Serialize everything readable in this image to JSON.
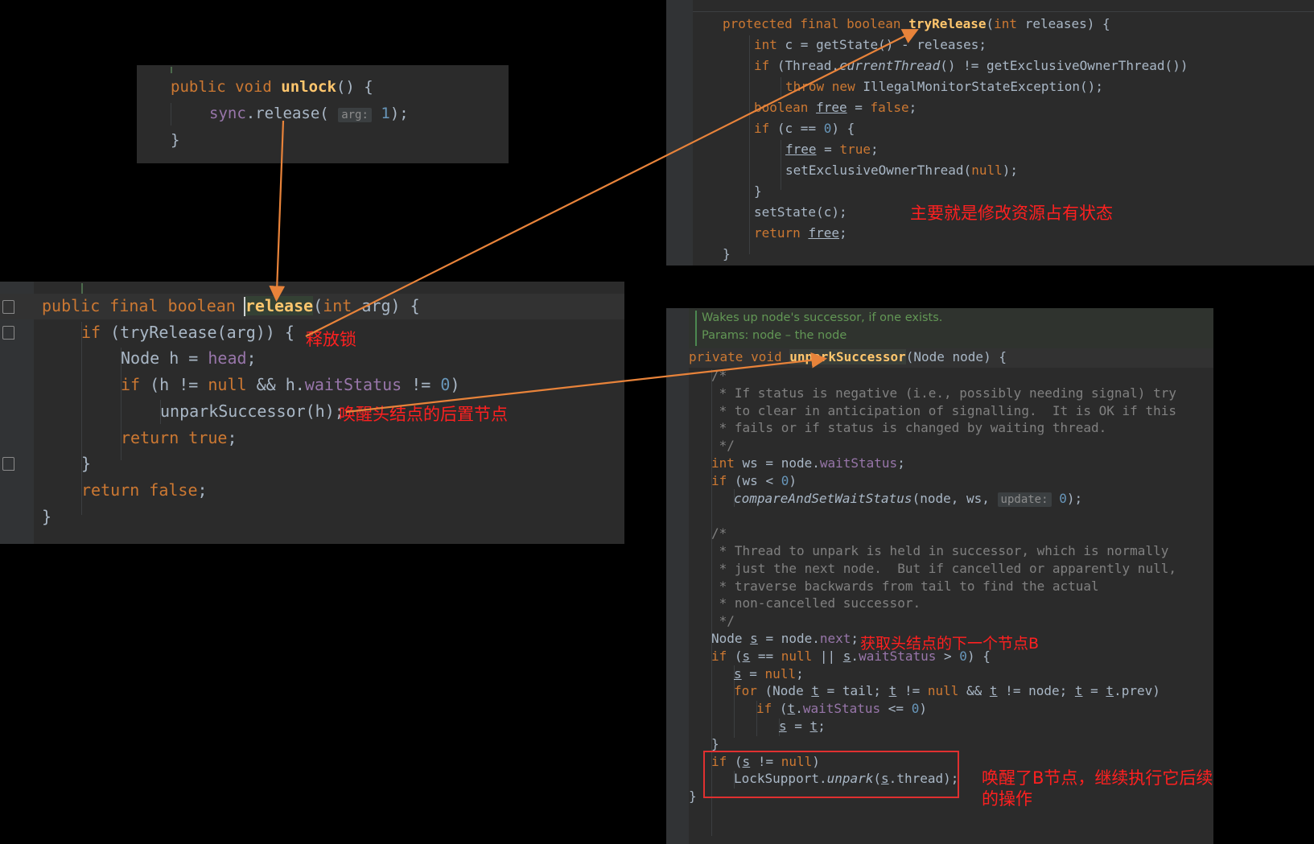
{
  "snippet_panel": {
    "name": "unlock-snippet",
    "lines": [
      {
        "indent": 0,
        "tokens": [
          {
            "t": "public ",
            "c": "kw"
          },
          {
            "t": "void ",
            "c": "kw"
          },
          {
            "t": "unlock",
            "c": "fnb"
          },
          {
            "t": "() {",
            "c": "plain"
          }
        ]
      },
      {
        "indent": 1,
        "tokens": [
          {
            "t": "sync",
            "c": "fld"
          },
          {
            "t": ".",
            "c": "plain"
          },
          {
            "t": "release",
            "c": "plain"
          },
          {
            "t": "( ",
            "c": "plain"
          },
          {
            "t": "arg:",
            "c": "hintbox"
          },
          {
            "t": " ",
            "c": "plain"
          },
          {
            "t": "1",
            "c": "num"
          },
          {
            "t": ");",
            "c": "plain"
          }
        ]
      },
      {
        "indent": 0,
        "tokens": [
          {
            "t": "}",
            "c": "plain"
          }
        ]
      }
    ]
  },
  "main_panel": {
    "name": "aqs-release-method",
    "lines": [
      {
        "indent": 0,
        "tokens": [
          {
            "t": "public ",
            "c": "kw"
          },
          {
            "t": "final ",
            "c": "kw"
          },
          {
            "t": "boolean ",
            "c": "kw"
          },
          {
            "t": "release",
            "c": "fnb sel"
          },
          {
            "t": "(",
            "c": "plain"
          },
          {
            "t": "int ",
            "c": "kw"
          },
          {
            "t": "arg",
            "c": "plain"
          },
          {
            "t": ") {",
            "c": "plain"
          }
        ]
      },
      {
        "indent": 1,
        "tokens": [
          {
            "t": "if ",
            "c": "kw"
          },
          {
            "t": "(tryRelease(arg)) {",
            "c": "plain"
          }
        ]
      },
      {
        "indent": 2,
        "tokens": [
          {
            "t": "Node h = ",
            "c": "plain"
          },
          {
            "t": "head",
            "c": "fld"
          },
          {
            "t": ";",
            "c": "plain"
          }
        ]
      },
      {
        "indent": 2,
        "tokens": [
          {
            "t": "if ",
            "c": "kw"
          },
          {
            "t": "(h != ",
            "c": "plain"
          },
          {
            "t": "null",
            "c": "kw"
          },
          {
            "t": " && h.",
            "c": "plain"
          },
          {
            "t": "waitStatus",
            "c": "fld"
          },
          {
            "t": " != ",
            "c": "plain"
          },
          {
            "t": "0",
            "c": "num"
          },
          {
            "t": ")",
            "c": "plain"
          }
        ]
      },
      {
        "indent": 3,
        "tokens": [
          {
            "t": "unparkSuccessor(h);",
            "c": "plain"
          }
        ]
      },
      {
        "indent": 2,
        "tokens": [
          {
            "t": "return ",
            "c": "kw"
          },
          {
            "t": "true",
            "c": "kw"
          },
          {
            "t": ";",
            "c": "plain"
          }
        ]
      },
      {
        "indent": 1,
        "tokens": [
          {
            "t": "}",
            "c": "plain"
          }
        ]
      },
      {
        "indent": 1,
        "tokens": [
          {
            "t": "return ",
            "c": "kw"
          },
          {
            "t": "false",
            "c": "kw"
          },
          {
            "t": ";",
            "c": "plain"
          }
        ]
      },
      {
        "indent": 0,
        "tokens": [
          {
            "t": "}",
            "c": "plain"
          }
        ]
      }
    ]
  },
  "top_right_panel": {
    "name": "try-release-method",
    "lines": [
      {
        "indent": 0,
        "tokens": [
          {
            "t": "protected ",
            "c": "kw"
          },
          {
            "t": "final ",
            "c": "kw"
          },
          {
            "t": "boolean ",
            "c": "kw"
          },
          {
            "t": "tryRelease",
            "c": "fnb"
          },
          {
            "t": "(",
            "c": "plain"
          },
          {
            "t": "int ",
            "c": "kw"
          },
          {
            "t": "releases",
            "c": "plain"
          },
          {
            "t": ") {",
            "c": "plain"
          }
        ]
      },
      {
        "indent": 1,
        "tokens": [
          {
            "t": "int ",
            "c": "kw"
          },
          {
            "t": "c = getState() - releases;",
            "c": "plain"
          }
        ]
      },
      {
        "indent": 1,
        "tokens": [
          {
            "t": "if ",
            "c": "kw"
          },
          {
            "t": "(Thread.",
            "c": "plain"
          },
          {
            "t": "currentThread",
            "c": "plain ital"
          },
          {
            "t": "() != getExclusiveOwnerThread())",
            "c": "plain"
          }
        ]
      },
      {
        "indent": 2,
        "tokens": [
          {
            "t": "throw ",
            "c": "kw"
          },
          {
            "t": "new ",
            "c": "kw"
          },
          {
            "t": "IllegalMonitorStateException();",
            "c": "plain"
          }
        ]
      },
      {
        "indent": 1,
        "tokens": [
          {
            "t": "boolean ",
            "c": "kw"
          },
          {
            "t": "free",
            "c": "loc"
          },
          {
            "t": " = ",
            "c": "plain"
          },
          {
            "t": "false",
            "c": "kw"
          },
          {
            "t": ";",
            "c": "plain"
          }
        ]
      },
      {
        "indent": 1,
        "tokens": [
          {
            "t": "if ",
            "c": "kw"
          },
          {
            "t": "(c == ",
            "c": "plain"
          },
          {
            "t": "0",
            "c": "num"
          },
          {
            "t": ") {",
            "c": "plain"
          }
        ]
      },
      {
        "indent": 2,
        "tokens": [
          {
            "t": "free",
            "c": "loc"
          },
          {
            "t": " = ",
            "c": "plain"
          },
          {
            "t": "true",
            "c": "kw"
          },
          {
            "t": ";",
            "c": "plain"
          }
        ]
      },
      {
        "indent": 2,
        "tokens": [
          {
            "t": "setExclusiveOwnerThread(",
            "c": "plain"
          },
          {
            "t": "null",
            "c": "kw"
          },
          {
            "t": ");",
            "c": "plain"
          }
        ]
      },
      {
        "indent": 1,
        "tokens": [
          {
            "t": "}",
            "c": "plain"
          }
        ]
      },
      {
        "indent": 1,
        "tokens": [
          {
            "t": "setState(c);",
            "c": "plain"
          }
        ]
      },
      {
        "indent": 1,
        "tokens": [
          {
            "t": "return ",
            "c": "kw"
          },
          {
            "t": "free",
            "c": "loc"
          },
          {
            "t": ";",
            "c": "plain"
          }
        ]
      },
      {
        "indent": 0,
        "tokens": [
          {
            "t": "}",
            "c": "plain"
          }
        ]
      }
    ]
  },
  "bottom_right_panel": {
    "name": "unpark-successor-method",
    "doc_lines": [
      "Wakes up node's successor, if one exists.",
      "Params: node – the node"
    ],
    "signature": [
      {
        "t": "private ",
        "c": "kw"
      },
      {
        "t": "void ",
        "c": "kw"
      },
      {
        "t": "unparkSuccessor",
        "c": "fnb hl"
      },
      {
        "t": "(Node node) {",
        "c": "plain"
      }
    ],
    "lines": [
      {
        "indent": 1,
        "tokens": [
          {
            "t": "/*",
            "c": "cmt"
          }
        ]
      },
      {
        "indent": 1,
        "tokens": [
          {
            "t": " * If status is negative (i.e., possibly needing signal) try",
            "c": "cmt"
          }
        ]
      },
      {
        "indent": 1,
        "tokens": [
          {
            "t": " * to clear in anticipation of signalling.  It is OK if this",
            "c": "cmt"
          }
        ]
      },
      {
        "indent": 1,
        "tokens": [
          {
            "t": " * fails or if status is changed by waiting thread.",
            "c": "cmt"
          }
        ]
      },
      {
        "indent": 1,
        "tokens": [
          {
            "t": " */",
            "c": "cmt"
          }
        ]
      },
      {
        "indent": 1,
        "tokens": [
          {
            "t": "int ",
            "c": "kw"
          },
          {
            "t": "ws = node.",
            "c": "plain"
          },
          {
            "t": "waitStatus",
            "c": "fld"
          },
          {
            "t": ";",
            "c": "plain"
          }
        ]
      },
      {
        "indent": 1,
        "tokens": [
          {
            "t": "if ",
            "c": "kw"
          },
          {
            "t": "(ws < ",
            "c": "plain"
          },
          {
            "t": "0",
            "c": "num"
          },
          {
            "t": ")",
            "c": "plain"
          }
        ]
      },
      {
        "indent": 2,
        "tokens": [
          {
            "t": "compareAndSetWaitStatus",
            "c": "plain ital"
          },
          {
            "t": "(node, ws, ",
            "c": "plain"
          },
          {
            "t": "update:",
            "c": "hintbox"
          },
          {
            "t": " ",
            "c": "plain"
          },
          {
            "t": "0",
            "c": "num"
          },
          {
            "t": ");",
            "c": "plain"
          }
        ]
      },
      {
        "indent": 1,
        "tokens": []
      },
      {
        "indent": 1,
        "tokens": [
          {
            "t": "/*",
            "c": "cmt"
          }
        ]
      },
      {
        "indent": 1,
        "tokens": [
          {
            "t": " * Thread to unpark is held in successor, which is normally",
            "c": "cmt"
          }
        ]
      },
      {
        "indent": 1,
        "tokens": [
          {
            "t": " * just the next node.  But if cancelled or apparently null,",
            "c": "cmt"
          }
        ]
      },
      {
        "indent": 1,
        "tokens": [
          {
            "t": " * traverse backwards from tail to find the actual",
            "c": "cmt"
          }
        ]
      },
      {
        "indent": 1,
        "tokens": [
          {
            "t": " * non-cancelled successor.",
            "c": "cmt"
          }
        ]
      },
      {
        "indent": 1,
        "tokens": [
          {
            "t": " */",
            "c": "cmt"
          }
        ]
      },
      {
        "indent": 1,
        "tokens": [
          {
            "t": "Node ",
            "c": "plain"
          },
          {
            "t": "s",
            "c": "loc"
          },
          {
            "t": " = node.",
            "c": "plain"
          },
          {
            "t": "next",
            "c": "fld"
          },
          {
            "t": ";",
            "c": "plain"
          }
        ]
      },
      {
        "indent": 1,
        "tokens": [
          {
            "t": "if ",
            "c": "kw"
          },
          {
            "t": "(",
            "c": "plain"
          },
          {
            "t": "s",
            "c": "loc"
          },
          {
            "t": " == ",
            "c": "plain"
          },
          {
            "t": "null",
            "c": "kw"
          },
          {
            "t": " || ",
            "c": "plain"
          },
          {
            "t": "s",
            "c": "loc"
          },
          {
            "t": ".",
            "c": "plain"
          },
          {
            "t": "waitStatus",
            "c": "fld"
          },
          {
            "t": " > ",
            "c": "plain"
          },
          {
            "t": "0",
            "c": "num"
          },
          {
            "t": ") {",
            "c": "plain"
          }
        ]
      },
      {
        "indent": 2,
        "tokens": [
          {
            "t": "s",
            "c": "loc"
          },
          {
            "t": " = ",
            "c": "plain"
          },
          {
            "t": "null",
            "c": "kw"
          },
          {
            "t": ";",
            "c": "plain"
          }
        ]
      },
      {
        "indent": 2,
        "tokens": [
          {
            "t": "for ",
            "c": "kw"
          },
          {
            "t": "(Node ",
            "c": "plain"
          },
          {
            "t": "t",
            "c": "loc"
          },
          {
            "t": " = ",
            "c": "plain"
          },
          {
            "t": "tail",
            "c": "plain"
          },
          {
            "t": "; ",
            "c": "plain"
          },
          {
            "t": "t",
            "c": "loc"
          },
          {
            "t": " != ",
            "c": "plain"
          },
          {
            "t": "null",
            "c": "kw"
          },
          {
            "t": " && ",
            "c": "plain"
          },
          {
            "t": "t",
            "c": "loc"
          },
          {
            "t": " != node; ",
            "c": "plain"
          },
          {
            "t": "t",
            "c": "loc"
          },
          {
            "t": " = ",
            "c": "plain"
          },
          {
            "t": "t",
            "c": "loc"
          },
          {
            "t": ".",
            "c": "plain"
          },
          {
            "t": "prev",
            "c": "plain"
          },
          {
            "t": ")",
            "c": "plain"
          }
        ]
      },
      {
        "indent": 3,
        "tokens": [
          {
            "t": "if ",
            "c": "kw"
          },
          {
            "t": "(",
            "c": "plain"
          },
          {
            "t": "t",
            "c": "loc"
          },
          {
            "t": ".",
            "c": "plain"
          },
          {
            "t": "waitStatus",
            "c": "fld"
          },
          {
            "t": " <= ",
            "c": "plain"
          },
          {
            "t": "0",
            "c": "num"
          },
          {
            "t": ")",
            "c": "plain"
          }
        ]
      },
      {
        "indent": 4,
        "tokens": [
          {
            "t": "s",
            "c": "loc"
          },
          {
            "t": " = ",
            "c": "plain"
          },
          {
            "t": "t",
            "c": "loc"
          },
          {
            "t": ";",
            "c": "plain"
          }
        ]
      },
      {
        "indent": 1,
        "tokens": [
          {
            "t": "}",
            "c": "plain"
          }
        ]
      },
      {
        "indent": 1,
        "tokens": [
          {
            "t": "if ",
            "c": "kw"
          },
          {
            "t": "(",
            "c": "plain"
          },
          {
            "t": "s",
            "c": "loc"
          },
          {
            "t": " != ",
            "c": "plain"
          },
          {
            "t": "null",
            "c": "kw"
          },
          {
            "t": ")",
            "c": "plain"
          }
        ]
      },
      {
        "indent": 2,
        "tokens": [
          {
            "t": "LockSupport.",
            "c": "plain"
          },
          {
            "t": "unpark",
            "c": "plain ital"
          },
          {
            "t": "(",
            "c": "plain"
          },
          {
            "t": "s",
            "c": "loc"
          },
          {
            "t": ".",
            "c": "plain"
          },
          {
            "t": "thread",
            "c": "plain"
          },
          {
            "t": ");",
            "c": "plain"
          }
        ]
      },
      {
        "indent": 0,
        "tokens": [
          {
            "t": "}",
            "c": "plain"
          }
        ]
      }
    ]
  },
  "annotations": [
    {
      "id": "ann-release-lock",
      "text": "释放锁"
    },
    {
      "id": "ann-wake-successor",
      "text": "唤醒头结点的后置节点"
    },
    {
      "id": "ann-modify-state",
      "text": "主要就是修改资源占有状态"
    },
    {
      "id": "ann-get-next-node",
      "text": "获取头结点的下一个节点B"
    },
    {
      "id": "ann-woke-b-node",
      "text": "唤醒了B节点，继续执行它后续\n的操作"
    }
  ],
  "colors": {
    "arrow": "#e8833a",
    "annotation": "#ff2020",
    "redbox": "#e03030",
    "editor_bg": "#2b2b2b",
    "gutter_bg": "#313335",
    "caret_line": "#323232"
  }
}
